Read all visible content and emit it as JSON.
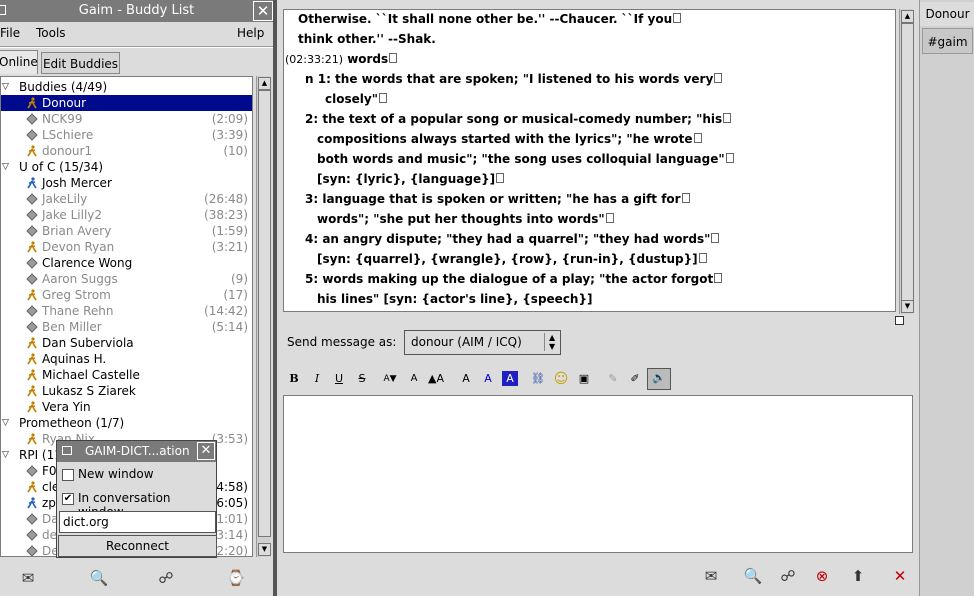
{
  "buddy_list": {
    "title": "Gaim - Buddy List",
    "close": "✕",
    "menu": [
      "File",
      "Tools",
      "Help"
    ],
    "tabs": [
      "Online",
      "Edit Buddies"
    ],
    "groups": [
      {
        "label": "Buddies (4/49)",
        "buddies": [
          {
            "name": "Donour",
            "time": "",
            "selected": true,
            "idle": false,
            "icon": "running-man-icon"
          },
          {
            "name": "NCK99",
            "time": "(2:09)",
            "idle": true,
            "icon": "away-diamond-icon"
          },
          {
            "name": "LSchiere",
            "time": "(3:39)",
            "idle": true,
            "icon": "away-diamond-icon"
          },
          {
            "name": "donour1",
            "time": "(10)",
            "idle": true,
            "icon": "running-man-icon"
          }
        ]
      },
      {
        "label": "U of C (15/34)",
        "buddies": [
          {
            "name": "Josh Mercer",
            "time": "",
            "idle": false,
            "icon": "blue-man-icon"
          },
          {
            "name": "JakeLily",
            "time": "(26:48)",
            "idle": true,
            "icon": "away-diamond-icon"
          },
          {
            "name": "Jake Lilly2",
            "time": "(38:23)",
            "idle": true,
            "icon": "away-diamond-icon"
          },
          {
            "name": "Brian Avery",
            "time": "(1:59)",
            "idle": true,
            "icon": "away-diamond-icon"
          },
          {
            "name": "Devon Ryan",
            "time": "(3:21)",
            "idle": true,
            "icon": "running-man-icon"
          },
          {
            "name": "Clarence Wong",
            "time": "",
            "idle": false,
            "icon": "away-diamond-icon"
          },
          {
            "name": "Aaron Suggs",
            "time": "(9)",
            "idle": true,
            "icon": "away-diamond-icon"
          },
          {
            "name": "Greg Strom",
            "time": "(17)",
            "idle": true,
            "icon": "running-man-icon"
          },
          {
            "name": "Thane Rehn",
            "time": "(14:42)",
            "idle": true,
            "icon": "away-diamond-icon"
          },
          {
            "name": "Ben Miller",
            "time": "(5:14)",
            "idle": true,
            "icon": "away-diamond-icon"
          },
          {
            "name": "Dan Suberviola",
            "time": "",
            "idle": false,
            "icon": "running-man-icon"
          },
          {
            "name": "Aquinas H.",
            "time": "",
            "idle": false,
            "icon": "running-man-icon"
          },
          {
            "name": "Michael Castelle",
            "time": "",
            "idle": false,
            "icon": "running-man-icon"
          },
          {
            "name": "Lukasz S Ziarek",
            "time": "",
            "idle": false,
            "icon": "running-man-icon"
          },
          {
            "name": "Vera Yin",
            "time": "",
            "idle": false,
            "icon": "running-man-icon"
          }
        ]
      },
      {
        "label": "Prometheon (1/7)",
        "buddies": [
          {
            "name": "Ryan Nix",
            "time": "(3:53)",
            "idle": true,
            "icon": "running-man-icon"
          }
        ]
      },
      {
        "label": "RPI (11",
        "buddies": [
          {
            "name": "F0",
            "time": "",
            "idle": false,
            "icon": "away-diamond-icon"
          },
          {
            "name": "cle",
            "time": "4:58)",
            "idle": false,
            "icon": "running-man-icon"
          },
          {
            "name": "zp",
            "time": "(6:05)",
            "idle": false,
            "icon": "blue-man-icon"
          },
          {
            "name": "Da",
            "time": "(1:01)",
            "idle": true,
            "icon": "away-diamond-icon"
          },
          {
            "name": "de",
            "time": "(3:14)",
            "idle": true,
            "icon": "away-diamond-icon"
          },
          {
            "name": "De",
            "time": "(2:20)",
            "idle": true,
            "icon": "away-diamond-icon"
          }
        ]
      }
    ]
  },
  "popup": {
    "title": "GAIM-DICT...ation",
    "close": "✕",
    "new_window": "New window",
    "in_conversation": "In conversation window",
    "server": "dict.org",
    "reconnect": "Reconnect"
  },
  "conversation": {
    "tabs": [
      "Donour",
      "#gaim"
    ],
    "log_lines": [
      {
        "text": "Otherwise. ``It shall none other be.'' --Chaucer. ``If you"
      },
      {
        "text": "think other.'' --Shak."
      },
      {
        "ts": "(02:33:21)",
        "text": "words"
      },
      {
        "text": "n 1: the words that are spoken; \"I listened to his words very"
      },
      {
        "text": "closely\""
      },
      {
        "text": "2: the text of a popular song or musical-comedy number; \"his"
      },
      {
        "text": "compositions always started with the lyrics\"; \"he wrote"
      },
      {
        "text": "both words and music\"; \"the song uses colloquial language\""
      },
      {
        "text": "[syn: {lyric}, {language}]"
      },
      {
        "text": "3: language that is spoken or written; \"he has a gift for"
      },
      {
        "text": "words\"; \"she put her thoughts into words\""
      },
      {
        "text": "4: an angry dispute; \"they had a quarrel\"; \"they had words\""
      },
      {
        "text": "[syn: {quarrel}, {wrangle}, {row}, {run-in}, {dustup}]"
      },
      {
        "text": "5: words making up the dialogue of a play; \"the actor forgot"
      },
      {
        "text": "his lines\" [syn: {actor's line}, {speech}]"
      }
    ],
    "send_as_label": "Send message as:",
    "send_as_value": "donour (AIM / ICQ)",
    "format_buttons": [
      "B",
      "I",
      "U",
      "S"
    ],
    "entry_value": ""
  }
}
